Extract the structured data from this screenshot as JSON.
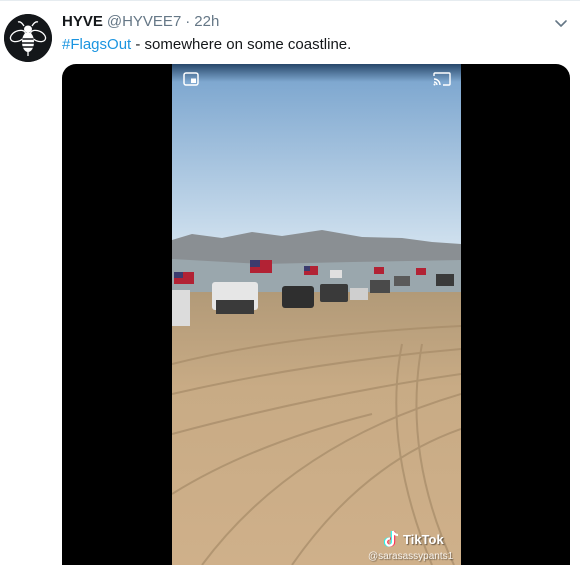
{
  "tweet": {
    "author": {
      "display_name": "HYVE",
      "handle": "@HYVEE7",
      "avatar_icon": "bee-icon"
    },
    "separator": "·",
    "timestamp": "22h",
    "text": {
      "hashtag": "#FlagsOut",
      "body": " - somewhere on some coastline."
    },
    "menu_icon": "chevron-down-icon"
  },
  "media": {
    "type": "video",
    "controls": {
      "pip_icon": "picture-in-picture-icon",
      "cast_icon": "cast-icon"
    },
    "watermark": {
      "logo_icon": "tiktok-note-icon",
      "brand": "TikTok",
      "username": "@sarasassypants1"
    }
  },
  "colors": {
    "link": "#1b95e0",
    "text": "#14171a",
    "secondary": "#657786",
    "media_bg": "#000000"
  }
}
